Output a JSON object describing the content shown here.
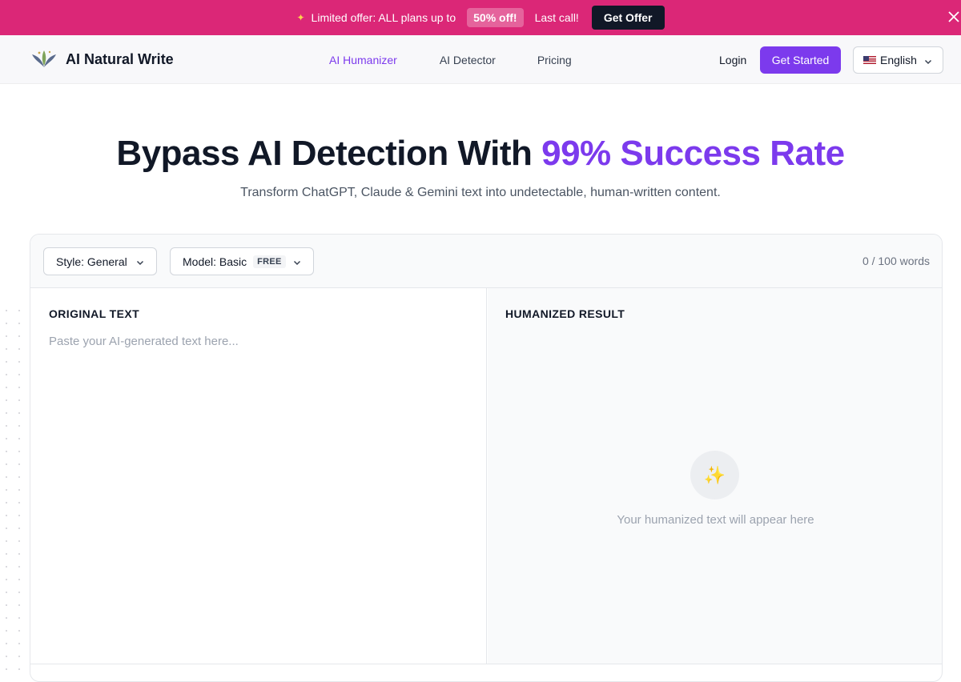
{
  "promo": {
    "text": "Limited offer: ALL plans up to",
    "badge": "50% off!",
    "urgency": "Last call!",
    "cta": "Get Offer",
    "background": "#db2777"
  },
  "nav": {
    "brand": "AI Natural Write",
    "links": [
      "AI Humanizer",
      "AI Detector",
      "Pricing"
    ],
    "active_link": "AI Humanizer",
    "login": "Login",
    "get_started": "Get Started",
    "language": "English",
    "accent": "#7c3aed"
  },
  "hero": {
    "title": "Bypass AI Detection With",
    "title_accent": "99% Success Rate",
    "subtitle": "Transform ChatGPT, Claude & Gemini text into undetectable, human-written content."
  },
  "editor": {
    "style_label": "Style: General",
    "model_label": "Model: Basic",
    "model_badge": "FREE",
    "word_count": "0 / 100 words",
    "original_label": "ORIGINAL TEXT",
    "original_placeholder": "Paste your AI-generated text here...",
    "original_value": "",
    "result_label": "HUMANIZED RESULT",
    "result_icon": "sparkles-icon",
    "result_empty": "Your humanized text will appear here"
  }
}
